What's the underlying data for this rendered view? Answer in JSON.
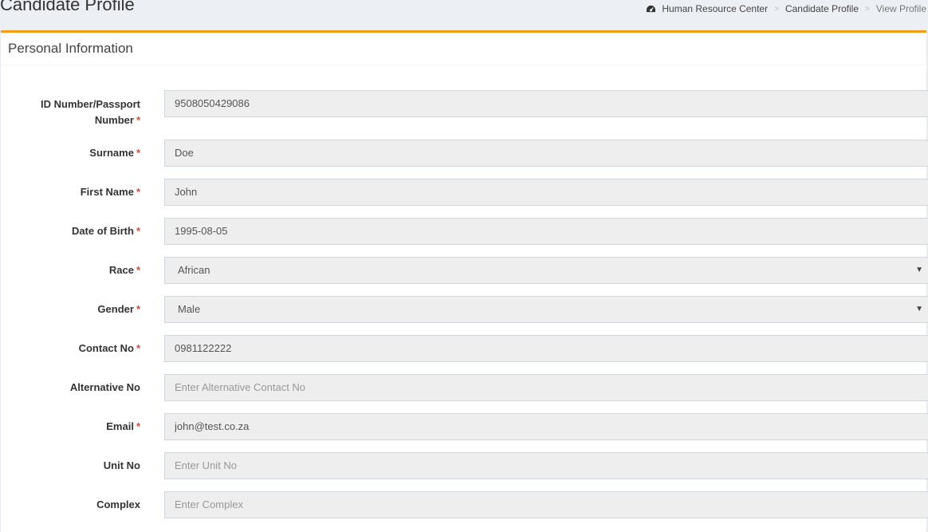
{
  "header": {
    "page_title": "Candidate Profile",
    "breadcrumb": [
      {
        "label": "Human Resource Center",
        "icon": "dashboard-icon"
      },
      {
        "label": "Candidate Profile"
      },
      {
        "label": "View Profile"
      }
    ]
  },
  "box": {
    "title": "Personal Information",
    "accent_color": "#f39c12"
  },
  "form": {
    "id_number": {
      "label": "ID Number/Passport Number",
      "value": "9508050429086",
      "required": true
    },
    "surname": {
      "label": "Surname",
      "value": "Doe",
      "required": true
    },
    "first_name": {
      "label": "First Name",
      "value": "John",
      "required": true
    },
    "dob": {
      "label": "Date of Birth",
      "value": "1995-08-05",
      "required": true
    },
    "race": {
      "label": "Race",
      "value": "African",
      "required": true
    },
    "gender": {
      "label": "Gender",
      "value": "Male",
      "required": true
    },
    "contact_no": {
      "label": "Contact No",
      "value": "0981122222",
      "required": true
    },
    "alt_no": {
      "label": "Alternative No",
      "placeholder": "Enter Alternative Contact No",
      "required": false
    },
    "email": {
      "label": "Email",
      "value": "john@test.co.za",
      "required": true
    },
    "unit_no": {
      "label": "Unit No",
      "placeholder": "Enter Unit No",
      "required": false
    },
    "complex": {
      "label": "Complex",
      "placeholder": "Enter Complex",
      "required": false
    },
    "required_mark": "*"
  }
}
